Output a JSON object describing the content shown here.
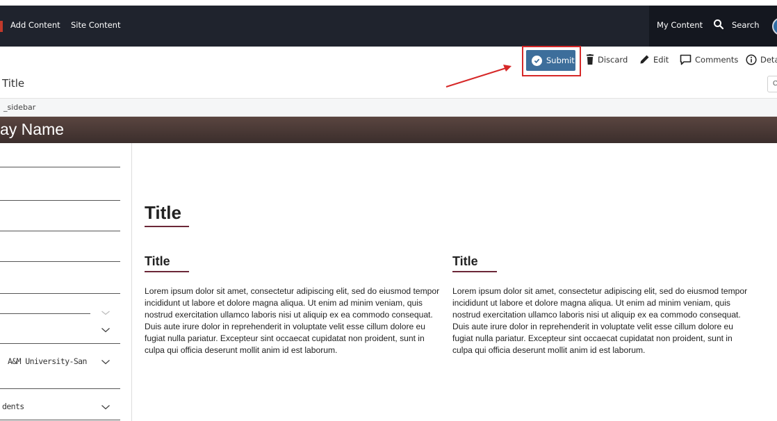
{
  "topbar": {
    "nav": [
      "Add Content",
      "Site Content"
    ],
    "my_content": "My Content",
    "search": "Search"
  },
  "toolbar": {
    "submit": "Submit",
    "discard": "Discard",
    "edit": "Edit",
    "comments": "Comments",
    "details": "Deta"
  },
  "page": {
    "title_field": "Title",
    "right_box": "C",
    "sidebar_label": "_sidebar",
    "banner": "ay Name"
  },
  "sidebar": {
    "items": [
      "A&M University-San",
      "dents"
    ]
  },
  "main": {
    "title": "Title",
    "columns": [
      {
        "title": "Title",
        "body": "Lorem ipsum dolor sit amet, consectetur adipiscing elit, sed do eiusmod tempor incididunt ut labore et dolore magna aliqua. Ut enim ad minim veniam, quis nostrud exercitation ullamco laboris nisi ut aliquip ex ea commodo consequat. Duis aute irure dolor in reprehenderit in voluptate velit esse cillum dolore eu fugiat nulla pariatur. Excepteur sint occaecat cupidatat non proident, sunt in culpa qui officia deserunt mollit anim id est laborum."
      },
      {
        "title": "Title",
        "body": "Lorem ipsum dolor sit amet, consectetur adipiscing elit, sed do eiusmod tempor incididunt ut labore et dolore magna aliqua. Ut enim ad minim veniam, quis nostrud exercitation ullamco laboris nisi ut aliquip ex ea commodo consequat. Duis aute irure dolor in reprehenderit in voluptate velit esse cillum dolore eu fugiat nulla pariatur. Excepteur sint occaecat cupidatat non proident, sunt in culpa qui officia deserunt mollit anim id est laborum."
      }
    ]
  },
  "colors": {
    "topbar": "#1f232d",
    "submit_button": "#3d6e9b",
    "highlight": "#d62828",
    "accent_underline": "#6b2737",
    "banner": "#4a3936"
  },
  "icons": [
    "check-circle-icon",
    "trash-icon",
    "pencil-icon",
    "comment-icon",
    "info-icon",
    "search-icon",
    "chevron-down-icon",
    "avatar"
  ]
}
